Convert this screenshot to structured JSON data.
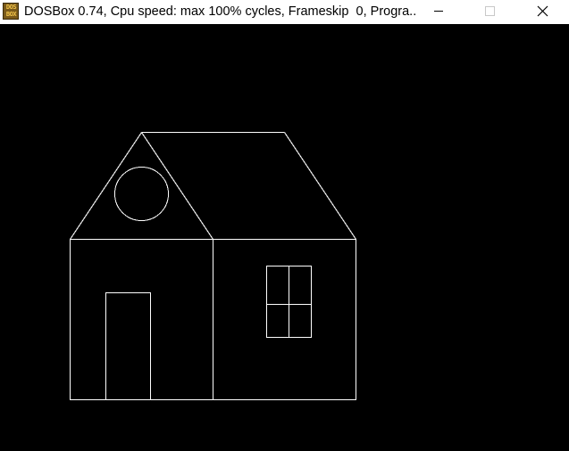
{
  "window": {
    "title": "DOSBox 0.74, Cpu speed: max 100% cycles, Frameskip  0, Progra...",
    "app_icon": {
      "name": "dosbox-icon",
      "line1": "DOS",
      "line2": "BOX"
    },
    "controls": {
      "minimize_icon": "minimize-icon",
      "maximize_icon": "maximize-icon",
      "close_icon": "close-icon"
    }
  },
  "screen": {
    "background_color": "#000000",
    "line_color": "#ffffff",
    "drawing": "house"
  },
  "colors": {
    "titlebar_bg": "#ffffff",
    "title_text": "#000000",
    "disabled_icon": "#c8c8c8"
  }
}
